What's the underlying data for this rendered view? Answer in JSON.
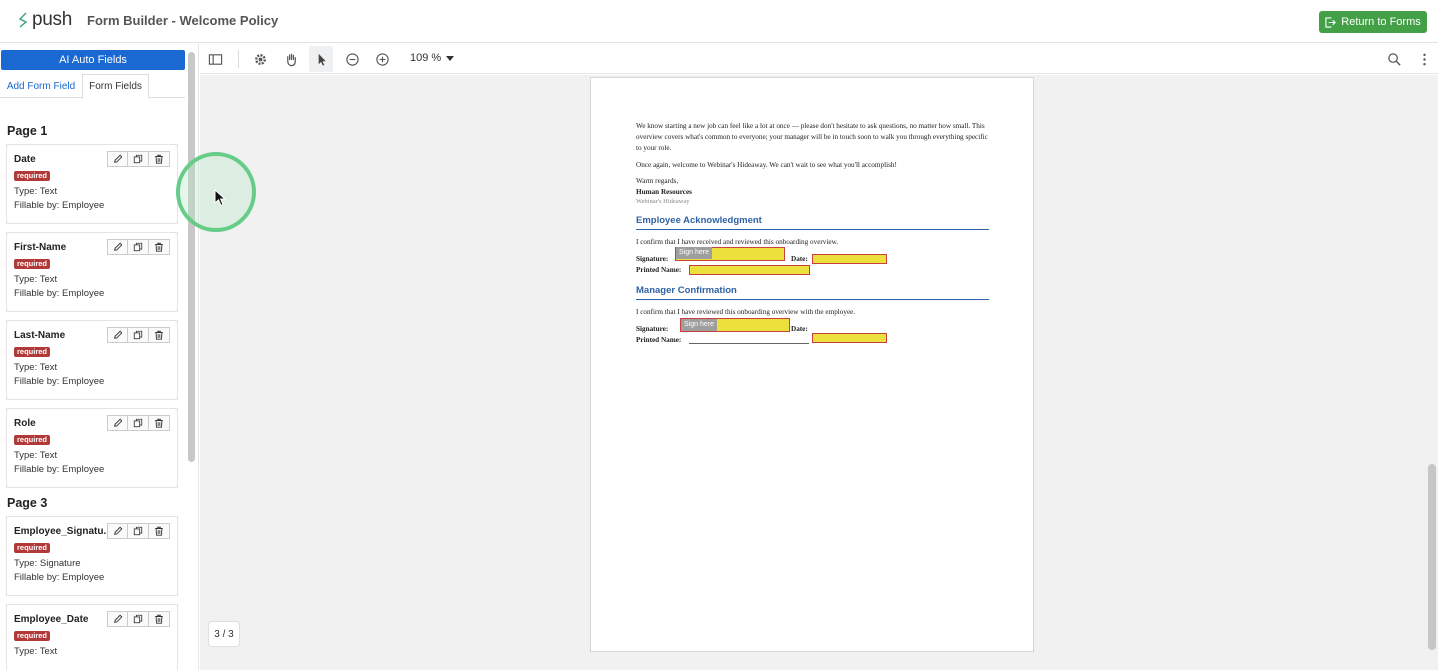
{
  "header": {
    "logo_text": "push",
    "title": "Form Builder - Welcome Policy",
    "return_label": "Return to Forms",
    "accent_color": "#43a047"
  },
  "sidebar": {
    "ai_button": "AI Auto Fields",
    "tabs": {
      "add": "Add Form Field",
      "fields": "Form Fields"
    },
    "pages": [
      {
        "heading": "Page 1",
        "fields": [
          {
            "name": "Date",
            "required": "required",
            "type": "Type: Text",
            "fillable": "Fillable by: Employee"
          },
          {
            "name": "First-Name",
            "required": "required",
            "type": "Type: Text",
            "fillable": "Fillable by: Employee"
          },
          {
            "name": "Last-Name",
            "required": "required",
            "type": "Type: Text",
            "fillable": "Fillable by: Employee"
          },
          {
            "name": "Role",
            "required": "required",
            "type": "Type: Text",
            "fillable": "Fillable by: Employee"
          }
        ]
      },
      {
        "heading": "Page 3",
        "fields": [
          {
            "name": "Employee_Signatu...",
            "required": "required",
            "type": "Type: Signature",
            "fillable": "Fillable by: Employee"
          },
          {
            "name": "Employee_Date",
            "required": "required",
            "type": "Type: Text",
            "fillable": ""
          }
        ]
      }
    ]
  },
  "toolbar": {
    "zoom": "109 %",
    "icons": [
      "sidebar-toggle-icon",
      "gear-icon",
      "hand-icon",
      "pointer-icon",
      "zoom-out-icon",
      "zoom-in-icon",
      "search-icon",
      "more-vertical-icon"
    ]
  },
  "document": {
    "intro": "We know starting a new job can feel like a lot at once — please don't hesitate to ask questions, no matter how small. This overview covers what's common to everyone; your manager will be in touch soon to walk you through everything specific to your role.",
    "welcome": "Once again, welcome to Webinar's Hideaway. We can't wait to see what you'll accomplish!",
    "regards": "Warm regards,",
    "signer": "Human Resources",
    "company": "Webinar's Hideaway",
    "ack_heading": "Employee Acknowledgment",
    "ack_text": "I confirm that I have received and reviewed this onboarding overview.",
    "mgr_heading": "Manager Confirmation",
    "mgr_text": "I confirm that I have reviewed this onboarding overview with the employee.",
    "signature_label": "Signature:",
    "date_label": "Date:",
    "printed_label": "Printed Name:",
    "sign_here": "Sign here"
  },
  "viewer": {
    "page_counter": "3 / 3"
  }
}
